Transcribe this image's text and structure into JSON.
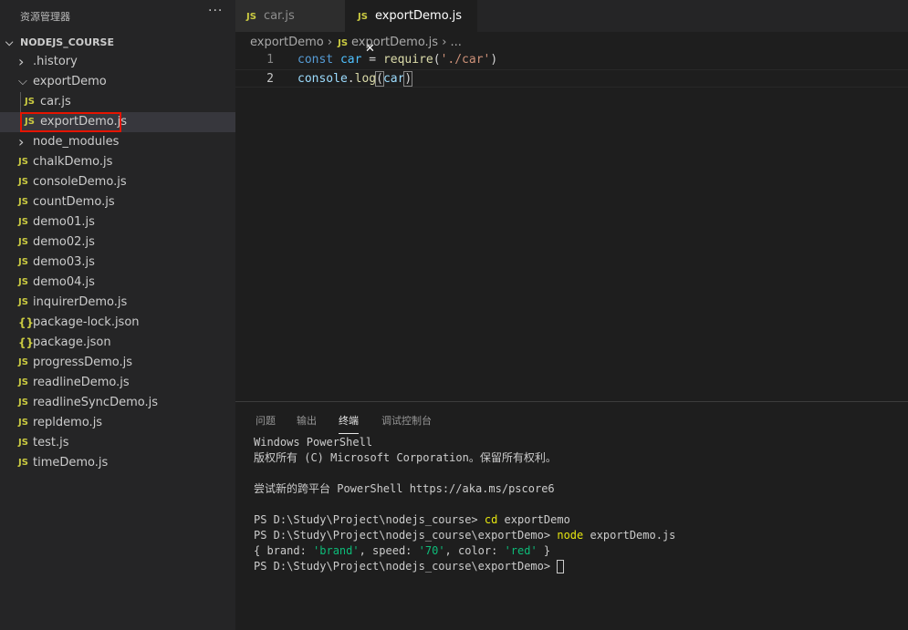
{
  "sidebar": {
    "title": "资源管理器",
    "more": "···",
    "root": "NODEJS_COURSE",
    "items": [
      {
        "label": ".history",
        "icon": "chevron-right"
      },
      {
        "label": "exportDemo",
        "icon": "chevron-down"
      },
      {
        "label": "car.js",
        "icon": "js"
      },
      {
        "label": "exportDemo.js",
        "icon": "js",
        "selected": true
      },
      {
        "label": "node_modules",
        "icon": "chevron-right"
      },
      {
        "label": "chalkDemo.js",
        "icon": "js"
      },
      {
        "label": "consoleDemo.js",
        "icon": "js"
      },
      {
        "label": "countDemo.js",
        "icon": "js"
      },
      {
        "label": "demo01.js",
        "icon": "js"
      },
      {
        "label": "demo02.js",
        "icon": "js"
      },
      {
        "label": "demo03.js",
        "icon": "js"
      },
      {
        "label": "demo04.js",
        "icon": "js"
      },
      {
        "label": "inquirerDemo.js",
        "icon": "js"
      },
      {
        "label": "package-lock.json",
        "icon": "json"
      },
      {
        "label": "package.json",
        "icon": "json"
      },
      {
        "label": "progressDemo.js",
        "icon": "js"
      },
      {
        "label": "readlineDemo.js",
        "icon": "js"
      },
      {
        "label": "readlineSyncDemo.js",
        "icon": "js"
      },
      {
        "label": "repldemo.js",
        "icon": "js"
      },
      {
        "label": "test.js",
        "icon": "js"
      },
      {
        "label": "timeDemo.js",
        "icon": "js"
      }
    ]
  },
  "tabs": [
    {
      "label": "car.js"
    },
    {
      "label": "exportDemo.js",
      "active": true
    }
  ],
  "js_badge": "JS",
  "json_badge": "{}",
  "close": "✕",
  "breadcrumb": {
    "folder": "exportDemo",
    "file": "exportDemo.js",
    "more": "..."
  },
  "code": {
    "l1": {
      "n": "1",
      "kw": "const",
      "var": "car",
      "eq": " = ",
      "fn": "require",
      "open": "(",
      "str": "'./car'",
      "close": ")"
    },
    "l2": {
      "n": "2",
      "obj": "console",
      "dot": ".",
      "fn": "log",
      "open": "(",
      "arg": "car",
      "close": ")"
    }
  },
  "panel": {
    "tabs": [
      "问题",
      "输出",
      "终端",
      "调试控制台"
    ],
    "active": "终端"
  },
  "terminal": {
    "l1": "Windows PowerShell",
    "l2": "版权所有 (C) Microsoft Corporation。保留所有权利。",
    "l3": "尝试新的跨平台 PowerShell https://aka.ms/pscore6",
    "p1": "PS D:\\Study\\Project\\nodejs_course> ",
    "c1": "cd",
    "a1": " exportDemo",
    "p2": "PS D:\\Study\\Project\\nodejs_course\\exportDemo> ",
    "c2": "node",
    "a2": " exportDemo.js",
    "o1": "{ brand: ",
    "s1": "'brand'",
    "o2": ", speed: ",
    "s2": "'70'",
    "o3": ", color: ",
    "s3": "'red'",
    "o4": " }",
    "p3": "PS D:\\Study\\Project\\nodejs_course\\exportDemo> "
  },
  "colors": {
    "accent_highlight": "#e51400",
    "keyword": "#569cd6",
    "function": "#dcdcaa",
    "string": "#ce9178",
    "variable": "#9cdcfe"
  }
}
